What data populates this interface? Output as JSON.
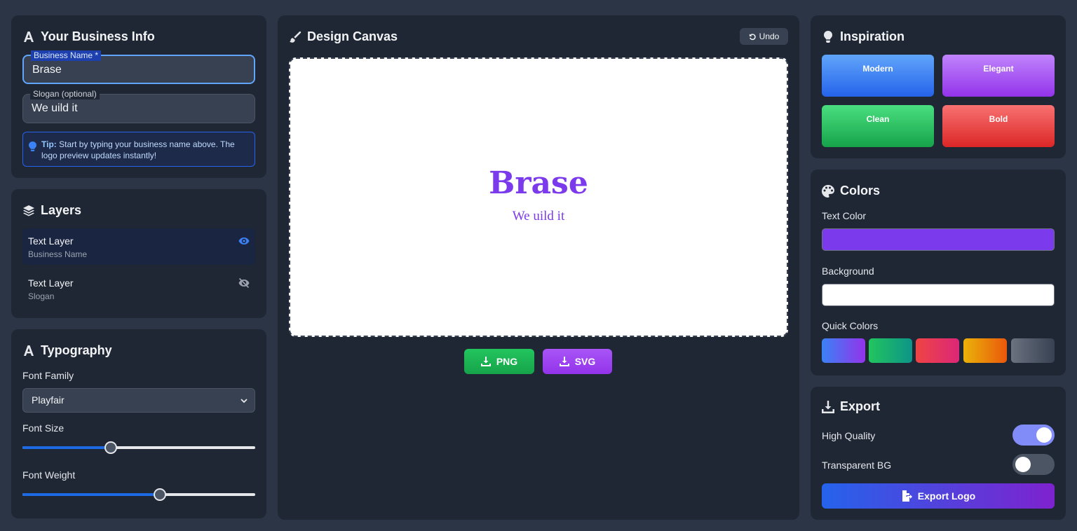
{
  "business_info": {
    "title": "Your Business Info",
    "name_label": "Business Name *",
    "name_value": "Brase",
    "slogan_label": "Slogan (optional)",
    "slogan_value": "We uild it",
    "tip_bold": "Tip:",
    "tip_text": "Start by typing your business name above. The logo preview updates instantly!"
  },
  "layers": {
    "title": "Layers",
    "items": [
      {
        "label": "Text Layer",
        "sub": "Business Name",
        "visible": true
      },
      {
        "label": "Text Layer",
        "sub": "Slogan",
        "visible": false
      }
    ]
  },
  "typography": {
    "title": "Typography",
    "font_family_label": "Font Family",
    "font_family_value": "Playfair",
    "font_size_label": "Font Size",
    "font_size_fraction": 0.38,
    "font_weight_label": "Font Weight",
    "font_weight_fraction": 0.59
  },
  "canvas": {
    "title": "Design Canvas",
    "undo_label": "Undo",
    "logo_name": "Brase",
    "logo_slogan": "We uild it",
    "png_label": "PNG",
    "svg_label": "SVG"
  },
  "inspiration": {
    "title": "Inspiration",
    "styles": [
      {
        "label": "Modern",
        "color_from": "#60a5fa",
        "color_to": "#2563eb"
      },
      {
        "label": "Elegant",
        "color_from": "#c084fc",
        "color_to": "#9333ea"
      },
      {
        "label": "Clean",
        "color_from": "#4ade80",
        "color_to": "#16a34a"
      },
      {
        "label": "Bold",
        "color_from": "#f87171",
        "color_to": "#dc2626"
      }
    ]
  },
  "colors": {
    "title": "Colors",
    "text_color_label": "Text Color",
    "text_color_value": "#7c3aed",
    "background_label": "Background",
    "background_value": "#ffffff",
    "quick_colors_label": "Quick Colors",
    "quick_colors": [
      {
        "from": "#3b82f6",
        "to": "#9333ea"
      },
      {
        "from": "#22c55e",
        "to": "#0d9488"
      },
      {
        "from": "#ef4444",
        "to": "#db2777"
      },
      {
        "from": "#eab308",
        "to": "#ea580c"
      },
      {
        "from": "#6b7280",
        "to": "#374151"
      }
    ]
  },
  "export": {
    "title": "Export",
    "high_quality_label": "High Quality",
    "high_quality_on": true,
    "transparent_label": "Transparent BG",
    "transparent_on": false,
    "export_button_label": "Export Logo"
  }
}
